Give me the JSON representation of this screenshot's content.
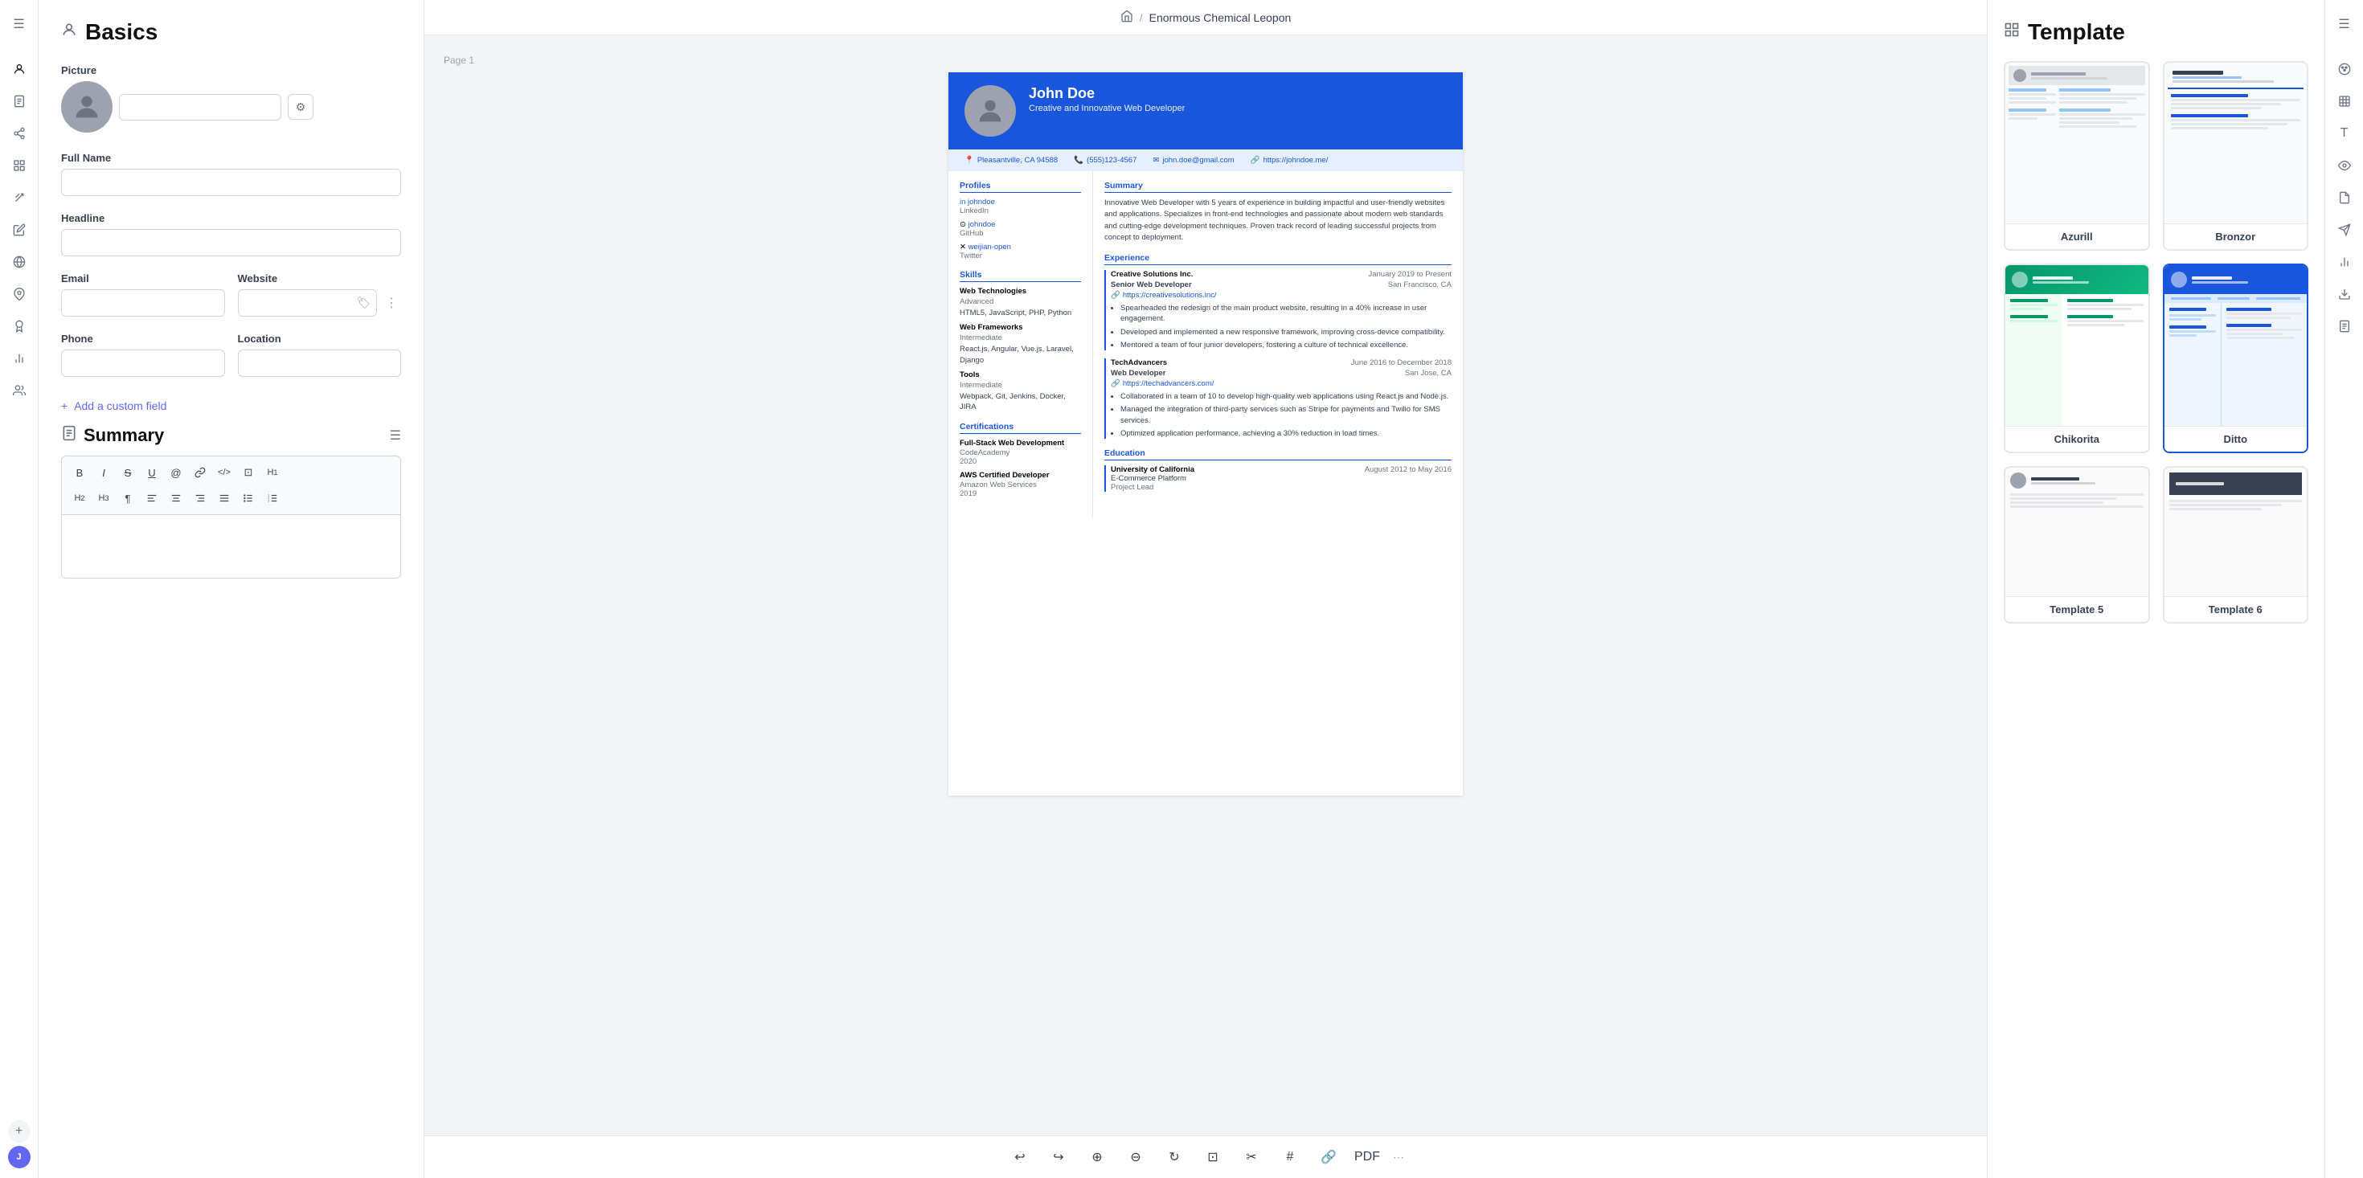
{
  "app": {
    "document_title": "Enormous Chemical Leopon"
  },
  "left_sidebar": {
    "icons": [
      {
        "name": "sidebar-toggle-icon",
        "symbol": "☰"
      },
      {
        "name": "person-icon",
        "symbol": "👤"
      },
      {
        "name": "document-icon",
        "symbol": "📄"
      },
      {
        "name": "share-icon",
        "symbol": "↗"
      },
      {
        "name": "grid-icon",
        "symbol": "⊞"
      },
      {
        "name": "star-icon",
        "symbol": "✦"
      },
      {
        "name": "pencil-icon",
        "symbol": "✏"
      },
      {
        "name": "language-icon",
        "symbol": "A"
      },
      {
        "name": "location-pin-icon",
        "symbol": "📍"
      },
      {
        "name": "bell-icon",
        "symbol": "🔔"
      },
      {
        "name": "settings-icon",
        "symbol": "⚙"
      },
      {
        "name": "users-icon",
        "symbol": "👥"
      },
      {
        "name": "add-icon",
        "symbol": "+"
      }
    ]
  },
  "basics_panel": {
    "title": "Basics",
    "picture_label": "Picture",
    "picture_url": "https://i.imgur.com/HgwyOuJ.jpg",
    "full_name_label": "Full Name",
    "full_name_value": "John Doe",
    "headline_label": "Headline",
    "headline_value": "Creative and Innovative Web Developer",
    "email_label": "Email",
    "email_value": "john.doe@gmail.com",
    "website_label": "Website",
    "website_value": "https://johndo",
    "phone_label": "Phone",
    "phone_value": "(555) 123-4567",
    "location_label": "Location",
    "location_value": "Pleasantville, CA 945",
    "add_custom_field_label": "Add a custom field",
    "summary_title": "Summary"
  },
  "preview": {
    "page_label": "Page 1",
    "resume": {
      "name": "John Doe",
      "headline": "Creative and Innovative Web Developer",
      "location": "Pleasantville, CA 94588",
      "phone": "(555)123-4567",
      "email": "john.doe@gmail.com",
      "website": "https://johndoe.me/",
      "profiles_title": "Profiles",
      "profile1_link": "johndoe",
      "profile1_platform": "LinkedIn",
      "profile2_link": "johndoe",
      "profile2_platform": "GitHub",
      "profile3_link": "weijian-open",
      "profile3_platform": "Twitter",
      "skills_title": "Skills",
      "skill1_name": "Web Technologies",
      "skill1_level": "Advanced",
      "skill1_items": "HTML5, JavaScript, PHP, Python",
      "skill2_name": "Web Frameworks",
      "skill2_level": "Intermediate",
      "skill2_items": "React.js, Angular, Vue.js, Laravel, Django",
      "skill3_name": "Tools",
      "skill3_level": "Intermediate",
      "skill3_items": "Webpack, Git, Jenkins, Docker, JIRA",
      "certs_title": "Certifications",
      "cert1_name": "Full-Stack Web Development",
      "cert1_issuer": "CodeAcademy",
      "cert1_date": "2020",
      "cert2_name": "AWS Certified Developer",
      "cert2_issuer": "Amazon Web Services",
      "cert2_date": "2019",
      "summary_title": "Summary",
      "summary_text": "Innovative Web Developer with 5 years of experience in building impactful and user-friendly websites and applications. Specializes in front-end technologies and passionate about modern web standards and cutting-edge development techniques. Proven track record of leading successful projects from concept to deployment.",
      "experience_title": "Experience",
      "exp1_company": "Creative Solutions Inc.",
      "exp1_dates": "January 2019 to Present",
      "exp1_title": "Senior Web Developer",
      "exp1_location": "San Francisco, CA",
      "exp1_link": "https://creativesolutions.inc/",
      "exp1_bullets": [
        "Spearheaded the redesign of the main product website, resulting in a 40% increase in user engagement.",
        "Developed and implemented a new responsive framework, improving cross-device compatibility.",
        "Mentored a team of four junior developers, fostering a culture of technical excellence."
      ],
      "exp2_company": "TechAdvancers",
      "exp2_dates": "June 2016 to December 2018",
      "exp2_title": "Web Developer",
      "exp2_location": "San Jose, CA",
      "exp2_link": "https://techadvancers.com/",
      "exp2_bullets": [
        "Collaborated in a team of 10 to develop high-quality web applications using React.js and Node.js.",
        "Managed the integration of third-party services such as Stripe for payments and Twilio for SMS services.",
        "Optimized application performance, achieving a 30% reduction in load times."
      ],
      "education_title": "Education",
      "edu1_school": "University of California",
      "edu1_dates": "August 2012 to May 2016",
      "edu1_degree": "E-Commerce Platform",
      "edu1_desc": "Project Lead"
    }
  },
  "template_panel": {
    "title": "Template",
    "templates": [
      {
        "id": "azurill",
        "name": "Azurill",
        "theme": "default"
      },
      {
        "id": "bronzor",
        "name": "Bronzor",
        "theme": "default"
      },
      {
        "id": "chikorita",
        "name": "Chikorita",
        "theme": "green"
      },
      {
        "id": "ditto",
        "name": "Ditto",
        "theme": "blue",
        "selected": true
      },
      {
        "id": "template5",
        "name": "Template 5",
        "theme": "default"
      },
      {
        "id": "template6",
        "name": "Template 6",
        "theme": "default"
      }
    ]
  },
  "toolbar": {
    "bold": "B",
    "italic": "I",
    "strikethrough": "S",
    "underline": "U",
    "at": "@",
    "link": "🔗",
    "code": "</>",
    "block": "⊡",
    "h1": "H₁",
    "h2": "H₂",
    "h3": "H₃",
    "paragraph": "¶",
    "align_left": "≡",
    "align_center": "≡",
    "align_right": "≡",
    "justify": "≡",
    "ul": "≡",
    "ol": "≡"
  }
}
